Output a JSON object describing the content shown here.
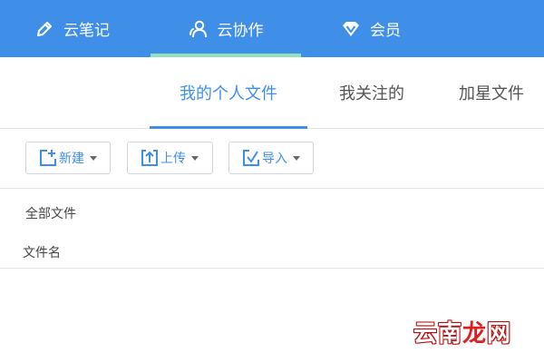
{
  "colors": {
    "nav_bg": "#3f8fe8",
    "nav_active_underline": "#8fe2b9",
    "accent": "#3f8fe8",
    "border": "#e3e3e3",
    "watermark_red": "#e11d1d"
  },
  "topnav": {
    "items": [
      {
        "label": "云笔记",
        "icon": "pencil-icon",
        "active": false
      },
      {
        "label": "云协作",
        "icon": "people-icon",
        "active": true
      },
      {
        "label": "会员",
        "icon": "diamond-icon",
        "active": false
      }
    ]
  },
  "subtabs": [
    {
      "label": "我的个人文件",
      "active": true
    },
    {
      "label": "我关注的",
      "active": false
    },
    {
      "label": "加星文件",
      "active": false
    }
  ],
  "toolbar": {
    "new_label": "新建",
    "new_icon": "new-file-icon",
    "upload_label": "上传",
    "upload_icon": "upload-icon",
    "import_label": "导入",
    "import_icon": "import-icon"
  },
  "files": {
    "breadcrumb": "全部文件",
    "column_name": "文件名"
  },
  "watermark": {
    "part1": "云南",
    "part2": "龙",
    "part3": "网"
  }
}
